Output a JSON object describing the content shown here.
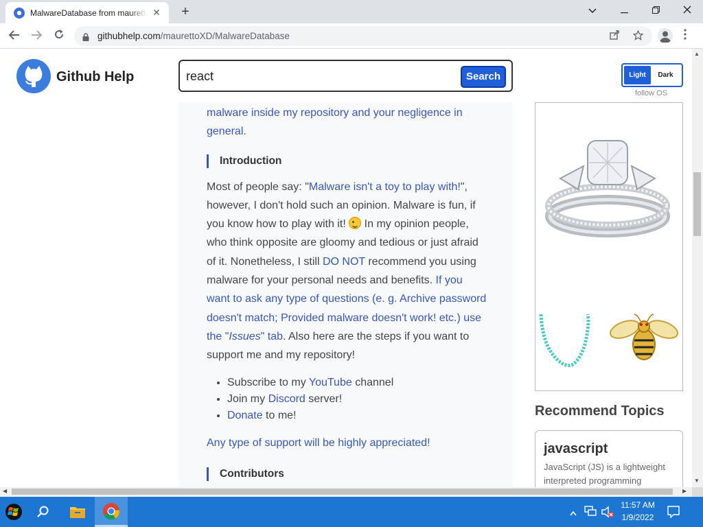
{
  "browser": {
    "tab_title": "MalwareDatabase from mauretto",
    "url_domain": "githubhelp.com",
    "url_path": "/maurettoXD/MalwareDatabase"
  },
  "site": {
    "name": "Github Help",
    "search_value": "react",
    "search_button": "Search",
    "theme_light": "Light",
    "theme_dark": "Dark",
    "theme_follow": "follow OS"
  },
  "article": {
    "intro_link": "malware inside my repository and your negligence in general.",
    "heading_intro": "Introduction",
    "p1_a": "Most of people say: \"",
    "p1_link1": "Malware isn't a toy to play with!",
    "p1_b": "\", however, I don't hold such an opinion. Malware is fun, if you know how to play with it! ",
    "p1_c": " In my opinion people, who think opposite are gloomy and tedious or just afraid of it. Nonetheless, I still ",
    "p1_link2": "DO NOT",
    "p1_d": " recommend you using malware for your personal needs and benefits. ",
    "p1_link3": "If you want to ask any type of questions (e. g. Archive password doesn't match; Provided malware doesn't work! etc.) use the \"",
    "p1_link3_em": "Issues",
    "p1_link3_end": "\" tab",
    "p1_e": ". Also here are the steps if you want to support me and my repository!",
    "list": [
      {
        "pre": "Subscribe to my ",
        "link": "YouTube",
        "post": " channel"
      },
      {
        "pre": "Join my ",
        "link": "Discord",
        "post": " server!"
      },
      {
        "pre": "",
        "link": "Donate",
        "post": " to me!"
      }
    ],
    "support_line": "Any type of support will be highly appreciated!",
    "heading_contrib": "Contributors"
  },
  "sidebar": {
    "recommend_title": "Recommend Topics",
    "topic_title": "javascript",
    "topic_desc": "JavaScript (JS) is a lightweight interpreted programming"
  },
  "taskbar": {
    "time": "11:57 AM",
    "date": "1/9/2022"
  },
  "colors": {
    "accent": "#1f5fd8",
    "link": "#3757b6",
    "taskbar": "#1d77d2",
    "tab_strip": "#dee1e6"
  }
}
